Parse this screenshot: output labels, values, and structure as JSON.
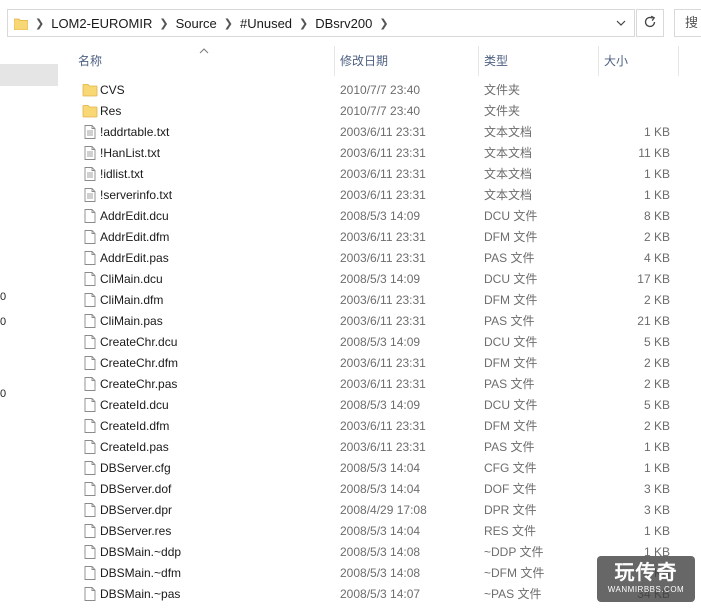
{
  "address": {
    "crumbs": [
      "LOM2-EUROMIR",
      "Source",
      "#Unused",
      "DBsrv200"
    ],
    "search_placeholder": "搜"
  },
  "nav": {
    "fragments": [
      "0",
      "0",
      "0"
    ]
  },
  "columns": {
    "name": "名称",
    "date": "修改日期",
    "type": "类型",
    "size": "大小"
  },
  "files": [
    {
      "name": "CVS",
      "date": "2010/7/7 23:40",
      "type": "文件夹",
      "size": "",
      "kind": "folder"
    },
    {
      "name": "Res",
      "date": "2010/7/7 23:40",
      "type": "文件夹",
      "size": "",
      "kind": "folder"
    },
    {
      "name": "!addrtable.txt",
      "date": "2003/6/11 23:31",
      "type": "文本文档",
      "size": "1 KB",
      "kind": "text"
    },
    {
      "name": "!HanList.txt",
      "date": "2003/6/11 23:31",
      "type": "文本文档",
      "size": "11 KB",
      "kind": "text"
    },
    {
      "name": "!idlist.txt",
      "date": "2003/6/11 23:31",
      "type": "文本文档",
      "size": "1 KB",
      "kind": "text"
    },
    {
      "name": "!serverinfo.txt",
      "date": "2003/6/11 23:31",
      "type": "文本文档",
      "size": "1 KB",
      "kind": "text"
    },
    {
      "name": "AddrEdit.dcu",
      "date": "2008/5/3 14:09",
      "type": "DCU 文件",
      "size": "8 KB",
      "kind": "file"
    },
    {
      "name": "AddrEdit.dfm",
      "date": "2003/6/11 23:31",
      "type": "DFM 文件",
      "size": "2 KB",
      "kind": "file"
    },
    {
      "name": "AddrEdit.pas",
      "date": "2003/6/11 23:31",
      "type": "PAS 文件",
      "size": "4 KB",
      "kind": "file"
    },
    {
      "name": "CliMain.dcu",
      "date": "2008/5/3 14:09",
      "type": "DCU 文件",
      "size": "17 KB",
      "kind": "file"
    },
    {
      "name": "CliMain.dfm",
      "date": "2003/6/11 23:31",
      "type": "DFM 文件",
      "size": "2 KB",
      "kind": "file"
    },
    {
      "name": "CliMain.pas",
      "date": "2003/6/11 23:31",
      "type": "PAS 文件",
      "size": "21 KB",
      "kind": "file"
    },
    {
      "name": "CreateChr.dcu",
      "date": "2008/5/3 14:09",
      "type": "DCU 文件",
      "size": "5 KB",
      "kind": "file"
    },
    {
      "name": "CreateChr.dfm",
      "date": "2003/6/11 23:31",
      "type": "DFM 文件",
      "size": "2 KB",
      "kind": "file"
    },
    {
      "name": "CreateChr.pas",
      "date": "2003/6/11 23:31",
      "type": "PAS 文件",
      "size": "2 KB",
      "kind": "file"
    },
    {
      "name": "CreateId.dcu",
      "date": "2008/5/3 14:09",
      "type": "DCU 文件",
      "size": "5 KB",
      "kind": "file"
    },
    {
      "name": "CreateId.dfm",
      "date": "2003/6/11 23:31",
      "type": "DFM 文件",
      "size": "2 KB",
      "kind": "file"
    },
    {
      "name": "CreateId.pas",
      "date": "2003/6/11 23:31",
      "type": "PAS 文件",
      "size": "1 KB",
      "kind": "file"
    },
    {
      "name": "DBServer.cfg",
      "date": "2008/5/3 14:04",
      "type": "CFG 文件",
      "size": "1 KB",
      "kind": "file"
    },
    {
      "name": "DBServer.dof",
      "date": "2008/5/3 14:04",
      "type": "DOF 文件",
      "size": "3 KB",
      "kind": "file"
    },
    {
      "name": "DBServer.dpr",
      "date": "2008/4/29 17:08",
      "type": "DPR 文件",
      "size": "3 KB",
      "kind": "file"
    },
    {
      "name": "DBServer.res",
      "date": "2008/5/3 14:04",
      "type": "RES 文件",
      "size": "1 KB",
      "kind": "file"
    },
    {
      "name": "DBSMain.~ddp",
      "date": "2008/5/3 14:08",
      "type": "~DDP 文件",
      "size": "1 KB",
      "kind": "file"
    },
    {
      "name": "DBSMain.~dfm",
      "date": "2008/5/3 14:08",
      "type": "~DFM 文件",
      "size": "3 KB",
      "kind": "file"
    },
    {
      "name": "DBSMain.~pas",
      "date": "2008/5/3 14:07",
      "type": "~PAS 文件",
      "size": "34 KB",
      "kind": "file"
    }
  ],
  "watermark": {
    "title": "玩传奇",
    "sub": "WANMIRBBS.COM"
  },
  "colors": {
    "folder": "#f8d775",
    "header_text": "#4d6082",
    "secondary_text": "#6d6d6d"
  }
}
